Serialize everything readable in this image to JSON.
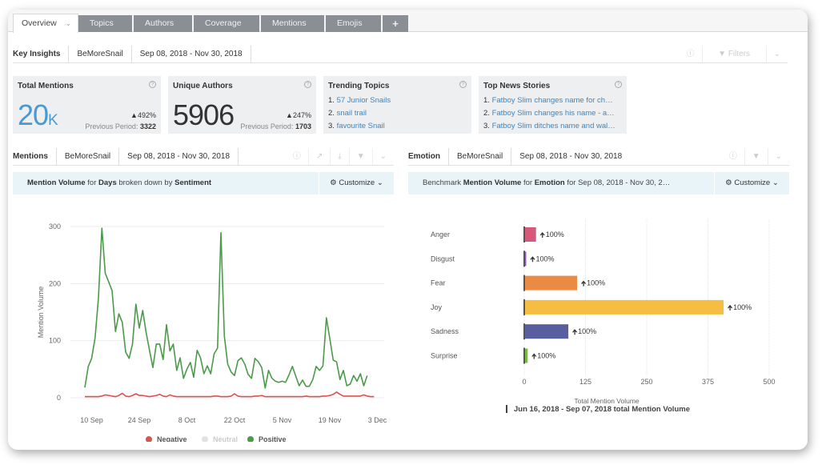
{
  "tabs": [
    {
      "label": "Overview",
      "active": true
    },
    {
      "label": "Topics"
    },
    {
      "label": "Authors"
    },
    {
      "label": "Coverage"
    },
    {
      "label": "Mentions"
    },
    {
      "label": "Emojis"
    },
    {
      "label": "+"
    }
  ],
  "insights_bar": {
    "title": "Key Insights",
    "query": "BeMoreSnail",
    "date_range": "Sep 08, 2018 - Nov 30, 2018",
    "filters_label": "Filters"
  },
  "cards": {
    "total_mentions": {
      "title": "Total Mentions",
      "value": "20",
      "unit": "K",
      "delta": "492%",
      "prev_label": "Previous Period:",
      "prev_value": "3322"
    },
    "unique_authors": {
      "title": "Unique Authors",
      "value": "5906",
      "delta": "247%",
      "prev_label": "Previous Period:",
      "prev_value": "1703"
    },
    "trending_topics": {
      "title": "Trending Topics",
      "items": [
        "57 Junior Snails",
        "snail trail",
        "favourite Snail"
      ]
    },
    "top_news": {
      "title": "Top News Stories",
      "items": [
        "Fatboy Slim changes name for ch…",
        "Fatboy Slim changes his name - a…",
        "Fatboy Slim ditches name and wal…"
      ]
    }
  },
  "mentions_panel": {
    "title": "Mentions",
    "query": "BeMoreSnail",
    "date_range": "Sep 08, 2018 - Nov 30, 2018",
    "desc_parts": [
      "Mention Volume",
      " for ",
      "Days",
      " broken down by ",
      "Sentiment"
    ],
    "customize_label": "Customize"
  },
  "emotion_panel": {
    "title": "Emotion",
    "query": "BeMoreSnail",
    "date_range": "Sep 08, 2018 - Nov 30, 2018",
    "desc_parts": [
      "Benchmark ",
      "Mention Volume",
      " for ",
      "Emotion",
      " for Sep 08, 2018 - Nov 30, 2…"
    ],
    "customize_label": "Customize",
    "benchmark_label": "Jun 16, 2018 - Sep 07, 2018 total Mention Volume"
  },
  "chart_data": [
    {
      "type": "line",
      "title": "Mention Volume for Days broken down by Sentiment",
      "xlabel": "",
      "ylabel": "Mention Volume",
      "ylim": [
        0,
        300
      ],
      "yticks": [
        0,
        100,
        200,
        300
      ],
      "x_start": "2018-09-08",
      "xticks": [
        {
          "label": "10 Sep",
          "day": 2
        },
        {
          "label": "24 Sep",
          "day": 16
        },
        {
          "label": "8 Oct",
          "day": 30
        },
        {
          "label": "22 Oct",
          "day": 44
        },
        {
          "label": "5 Nov",
          "day": 58
        },
        {
          "label": "19 Nov",
          "day": 72
        },
        {
          "label": "3 Dec",
          "day": 86
        }
      ],
      "grid": true,
      "legend_position": "bottom",
      "series": [
        {
          "name": "Negative",
          "color": "#d9534f",
          "enabled": true,
          "values": [
            2,
            2,
            2,
            2,
            2,
            3,
            5,
            4,
            3,
            2,
            4,
            8,
            3,
            2,
            4,
            7,
            4,
            4,
            3,
            2,
            3,
            4,
            6,
            3,
            2,
            5,
            3,
            2,
            2,
            2,
            2,
            2,
            2,
            2,
            2,
            2,
            2,
            2,
            3,
            3,
            2,
            2,
            2,
            3,
            7,
            3,
            2,
            2,
            2,
            2,
            3,
            3,
            4,
            2,
            2,
            2,
            2,
            2,
            2,
            2,
            2,
            2,
            2,
            2,
            2,
            3,
            2,
            2,
            2,
            2,
            3,
            3,
            4,
            6,
            10,
            6,
            3,
            3,
            3,
            3,
            3,
            3,
            5,
            3,
            2,
            2
          ]
        },
        {
          "name": "Neutral",
          "color": "#dddddd",
          "enabled": false,
          "values": []
        },
        {
          "name": "Positive",
          "color": "#4a9a4a",
          "enabled": true,
          "values": [
            18,
            55,
            69,
            105,
            175,
            297,
            218,
            203,
            188,
            116,
            147,
            132,
            80,
            69,
            94,
            164,
            122,
            153,
            115,
            83,
            53,
            94,
            94,
            67,
            128,
            82,
            94,
            48,
            70,
            34,
            50,
            62,
            36,
            83,
            70,
            42,
            56,
            42,
            77,
            87,
            289,
            108,
            59,
            45,
            39,
            65,
            70,
            59,
            41,
            34,
            69,
            63,
            53,
            17,
            48,
            34,
            29,
            27,
            29,
            27,
            40,
            55,
            38,
            21,
            31,
            20,
            20,
            32,
            55,
            48,
            56,
            140,
            104,
            66,
            63,
            32,
            48,
            21,
            24,
            39,
            29,
            42,
            21,
            39
          ]
        }
      ]
    },
    {
      "type": "bar",
      "orientation": "horizontal",
      "title": "Benchmark Mention Volume for Emotion",
      "xlabel": "Total Mention Volume",
      "ylabel": "",
      "xlim": [
        0,
        500
      ],
      "xticks": [
        0,
        125,
        250,
        375,
        500
      ],
      "grid": true,
      "categories": [
        "Anger",
        "Disgust",
        "Fear",
        "Joy",
        "Sadness",
        "Surprise"
      ],
      "values": [
        24,
        4,
        108,
        407,
        90,
        7
      ],
      "colors": [
        "#d6587a",
        "#8a5cb8",
        "#ea8a45",
        "#f5bd42",
        "#595ea0",
        "#7ab844"
      ],
      "data_labels": [
        "100%",
        "100%",
        "100%",
        "100%",
        "100%",
        "100%"
      ],
      "label_icon": "arrow-up-icon"
    }
  ]
}
